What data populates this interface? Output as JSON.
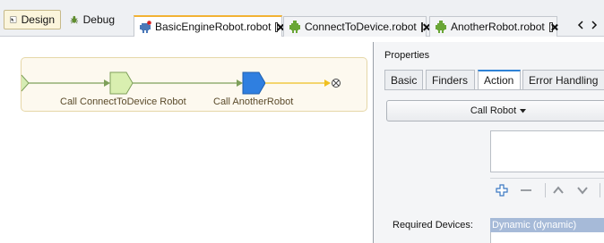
{
  "toolbar": {
    "design_label": "Design",
    "debug_label": "Debug"
  },
  "tabs": [
    {
      "label": "BasicEngineRobot.robot",
      "active": true
    },
    {
      "label": "ConnectToDevice.robot",
      "active": false
    },
    {
      "label": "AnotherRobot.robot",
      "active": false
    }
  ],
  "flow": {
    "steps": [
      {
        "label": "Call ConnectToDevice Robot",
        "color": "#d9efb0"
      },
      {
        "label": "Call AnotherRobot",
        "color": "#2f7fe0"
      }
    ],
    "connector_color_done": "#7ea05a",
    "connector_color_pending": "#f0c020"
  },
  "properties": {
    "title": "Properties",
    "tabs": [
      "Basic",
      "Finders",
      "Action",
      "Error Handling"
    ],
    "active_tab": "Action",
    "call_button_label": "Call Robot",
    "required_devices_label": "Required Devices:",
    "required_devices_value": "Dynamic (dynamic)"
  },
  "colors": {
    "accent_tab": "#f2b233",
    "selection": "#a6bad8"
  }
}
